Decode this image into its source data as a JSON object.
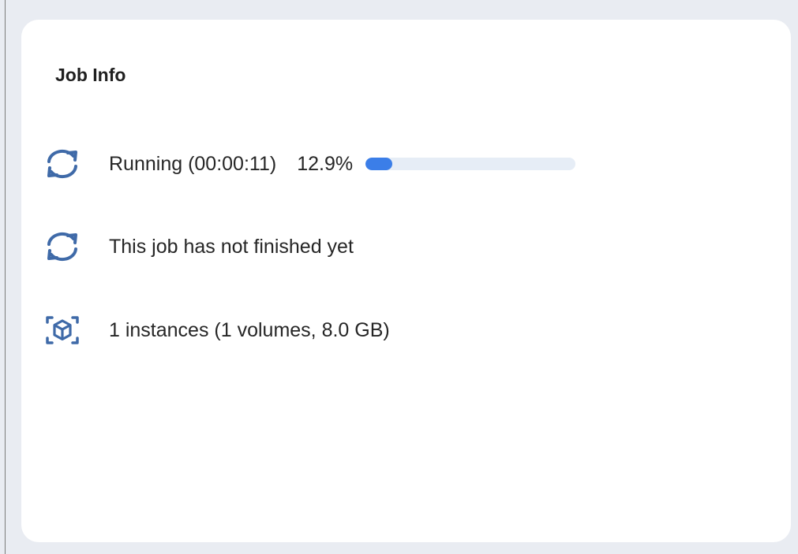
{
  "card": {
    "title": "Job Info",
    "status": {
      "icon": "sync-icon",
      "text": "Running (00:00:11)",
      "percent_text": "12.9%",
      "progress_fraction": 0.129,
      "progress_color": "#3b7ee8",
      "track_color": "#e6edf6"
    },
    "finish": {
      "icon": "sync-icon",
      "text": "This job has not finished yet"
    },
    "instances": {
      "icon": "instance-cube-icon",
      "text": "1 instances (1 volumes, 8.0 GB)"
    }
  },
  "colors": {
    "icon": "#3f6aa8",
    "background": "#e9ecf2",
    "card": "#ffffff"
  }
}
